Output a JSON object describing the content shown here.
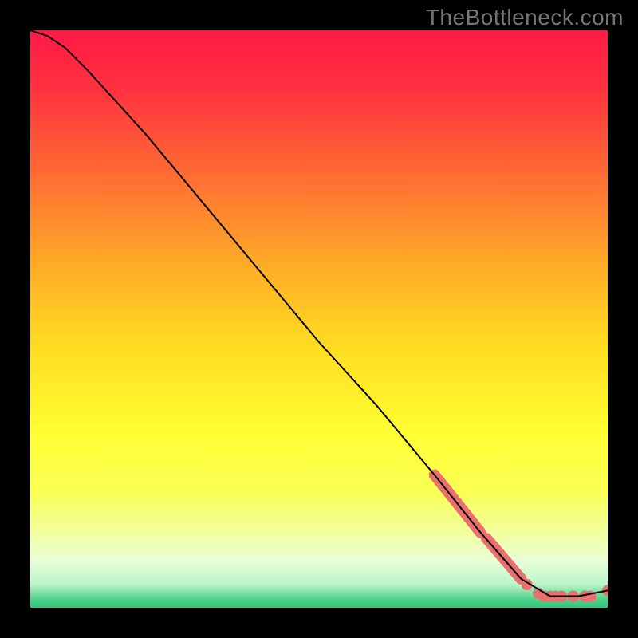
{
  "watermark": "TheBottleneck.com",
  "gradient_stops": [
    {
      "offset": 0.0,
      "color": "#ff1a46"
    },
    {
      "offset": 0.1,
      "color": "#ff3140"
    },
    {
      "offset": 0.25,
      "color": "#ff6c33"
    },
    {
      "offset": 0.4,
      "color": "#ffa928"
    },
    {
      "offset": 0.55,
      "color": "#ffdd1f"
    },
    {
      "offset": 0.7,
      "color": "#ffff33"
    },
    {
      "offset": 0.8,
      "color": "#f9ff55"
    },
    {
      "offset": 0.87,
      "color": "#f2ffa0"
    },
    {
      "offset": 0.92,
      "color": "#e8ffd8"
    },
    {
      "offset": 0.96,
      "color": "#b8f5c7"
    },
    {
      "offset": 0.985,
      "color": "#4fd28a"
    },
    {
      "offset": 1.0,
      "color": "#2cc779"
    }
  ],
  "chart_data": {
    "type": "line",
    "title": "",
    "xlabel": "",
    "ylabel": "",
    "xlim": [
      0,
      100
    ],
    "ylim": [
      0,
      100
    ],
    "series": [
      {
        "name": "bottleneck-curve",
        "x": [
          0,
          3,
          6,
          10,
          20,
          30,
          40,
          50,
          60,
          70,
          78,
          85,
          90,
          95,
          100
        ],
        "y": [
          100,
          99,
          97,
          93,
          82,
          70,
          58,
          46,
          35,
          23,
          13,
          5,
          2,
          2,
          3
        ]
      }
    ],
    "highlight_segments": [
      {
        "x0": 70,
        "y0": 23,
        "x1": 78,
        "y1": 13
      },
      {
        "x0": 79,
        "y0": 12,
        "x1": 85,
        "y1": 5
      }
    ],
    "highlight_points": [
      {
        "x": 86,
        "y": 4.0
      },
      {
        "x": 88,
        "y": 2.5
      },
      {
        "x": 89,
        "y": 2.0
      },
      {
        "x": 90,
        "y": 2.0
      },
      {
        "x": 91,
        "y": 2.0
      },
      {
        "x": 92,
        "y": 2.0
      },
      {
        "x": 94,
        "y": 2.0
      },
      {
        "x": 96,
        "y": 2.0
      },
      {
        "x": 97,
        "y": 2.0
      },
      {
        "x": 100,
        "y": 3.0
      }
    ],
    "style": {
      "line_color": "#000000",
      "line_width": 2,
      "highlight_color": "#e9706f",
      "highlight_segment_width": 14,
      "highlight_point_radius": 7
    }
  }
}
